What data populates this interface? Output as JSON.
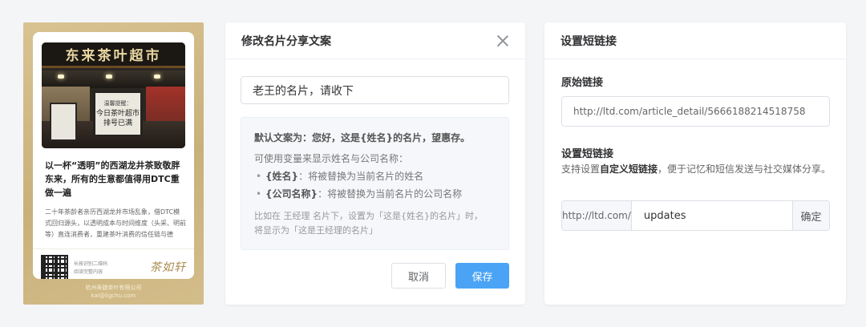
{
  "card": {
    "sign_text": "东来茶叶超市",
    "notice_heading": "温馨提醒：",
    "notice_line1": "今日茶叶超市",
    "notice_line2": "排号已满",
    "title": "以一杯“透明”的西湖龙井茶致敬胖东来，所有的生意都值得用DTC重做一遍",
    "body": "二十年茶龄者亲历西湖龙井市场乱象，借DTC模式回归源头，以透明成本与时间维度（头采、明前等）直连消费者，重建茶叶消费的信任链与德",
    "qr_caption_line1": "长按识别二维码",
    "qr_caption_line2": "阅读完整内容",
    "logo": "茶如轩",
    "company_name": "杭州寿膳茶叶有限公司",
    "company_email": "kai@ligchu.com"
  },
  "edit_panel": {
    "title": "修改名片分享文案",
    "input_value": "老王的名片，请收下",
    "hint_default": "默认文案为：您好，这是{姓名}的名片，望惠存。",
    "hint_intro": "可使用变量来显示姓名与公司名称：",
    "variables": [
      {
        "token": "{姓名}",
        "desc": "：将被替换为当前名片的姓名"
      },
      {
        "token": "{公司名称}",
        "desc": "：将被替换为当前名片的公司名称"
      }
    ],
    "example_line1": "比如在 王经理 名片下，设置为「这是{姓名}的名片」时，",
    "example_line2": "将显示为「这是王经理的名片」",
    "cancel_label": "取消",
    "save_label": "保存"
  },
  "short_panel": {
    "title": "设置短链接",
    "original_label": "原始链接",
    "original_url": "http://ltd.com/article_detail/5666188214518758",
    "short_label": "设置短链接",
    "desc_prefix": "支持设置",
    "desc_bold": "自定义短链接",
    "desc_suffix": "，便于记忆和短信发送与社交媒体分享。",
    "domain_prefix": "http://ltd.com/",
    "suffix_value": "updates",
    "confirm_label": "确定"
  },
  "colors": {
    "primary": "#4aa3f5",
    "card_gold": "#d3bd8a",
    "background": "#f4f5f7"
  }
}
